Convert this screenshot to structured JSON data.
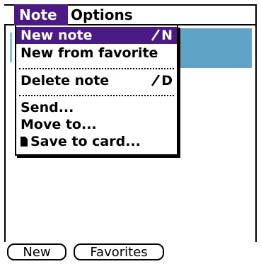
{
  "menubar": {
    "active_menu": "Note",
    "other_menu": "Options"
  },
  "note_menu": {
    "items": [
      {
        "label": "New note",
        "shortcut": "N",
        "selected": true
      },
      {
        "label": "New from favorite",
        "shortcut": "",
        "selected": false
      },
      {
        "label": "Delete note",
        "shortcut": "D",
        "selected": false
      },
      {
        "label": "Send...",
        "shortcut": "",
        "selected": false
      },
      {
        "label": "Move to...",
        "shortcut": "",
        "selected": false
      },
      {
        "label": "Save to card...",
        "shortcut": "",
        "selected": false,
        "icon": "memory-card-icon"
      }
    ]
  },
  "buttons": {
    "new_label": "New",
    "favorites_label": "Favorites"
  },
  "colors": {
    "selection": "#4a1a86",
    "content_block": "#5fa3c6"
  }
}
